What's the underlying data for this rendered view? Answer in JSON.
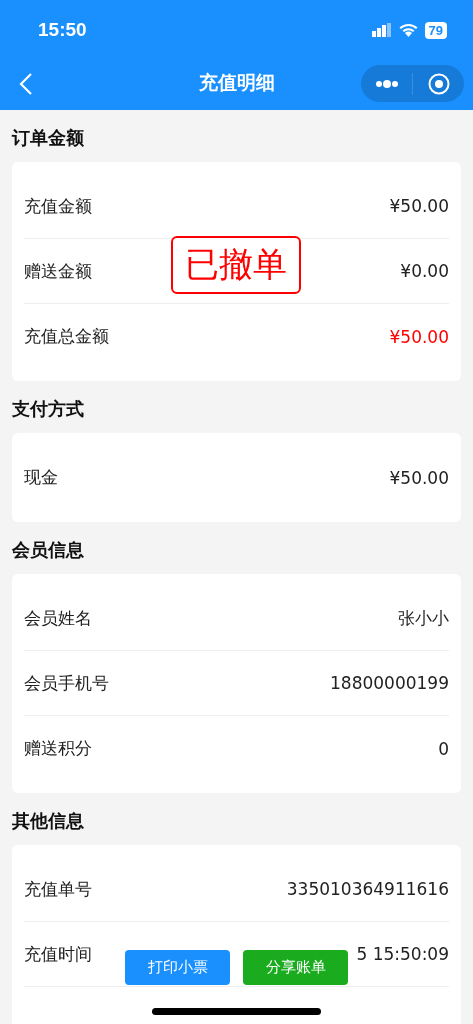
{
  "status_bar": {
    "time": "15:50",
    "battery": "79"
  },
  "nav": {
    "title": "充值明细"
  },
  "stamp": "已撤单",
  "sections": [
    {
      "title": "订单金额",
      "rows": [
        {
          "label": "充值金额",
          "value": "¥50.00",
          "highlight": false
        },
        {
          "label": "赠送金额",
          "value": "¥0.00",
          "highlight": false
        },
        {
          "label": "充值总金额",
          "value": "¥50.00",
          "highlight": true
        }
      ]
    },
    {
      "title": "支付方式",
      "rows": [
        {
          "label": "现金",
          "value": "¥50.00",
          "highlight": false
        }
      ]
    },
    {
      "title": "会员信息",
      "rows": [
        {
          "label": "会员姓名",
          "value": "张小小",
          "highlight": false
        },
        {
          "label": "会员手机号",
          "value": "18800000199",
          "highlight": false
        },
        {
          "label": "赠送积分",
          "value": "0",
          "highlight": false
        }
      ]
    },
    {
      "title": "其他信息",
      "rows": [
        {
          "label": "充值单号",
          "value": "335010364911616",
          "highlight": false
        },
        {
          "label": "充值时间",
          "value": "5 15:50:09",
          "highlight": false
        }
      ]
    }
  ],
  "actions": [
    {
      "label": "打印小票",
      "kind": "print"
    },
    {
      "label": "分享账单",
      "kind": "share"
    }
  ]
}
